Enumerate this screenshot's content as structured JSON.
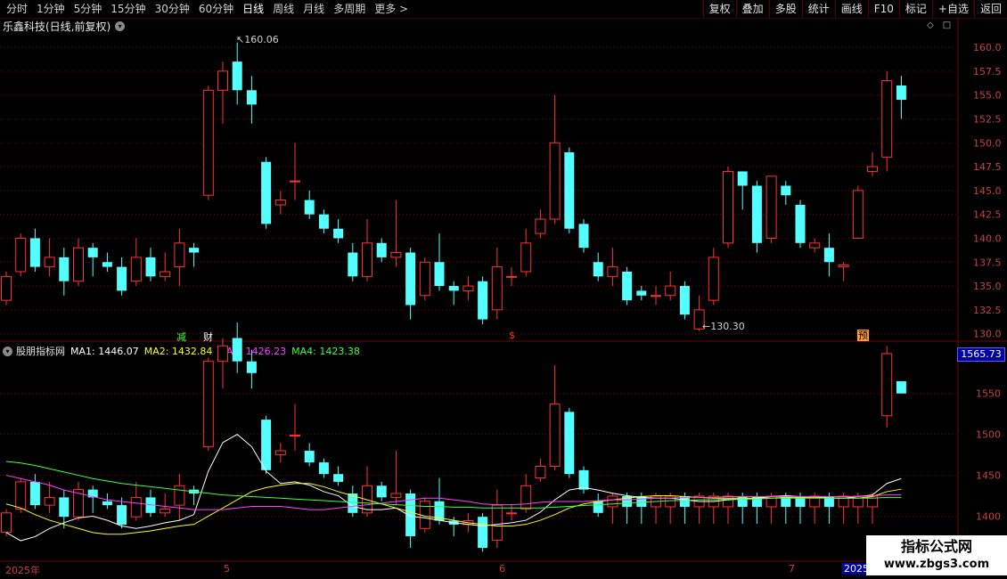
{
  "toolbar": {
    "periods": [
      "分时",
      "1分钟",
      "5分钟",
      "15分钟",
      "30分钟",
      "60分钟",
      "日线",
      "周线",
      "月线",
      "多周期",
      "更多 >"
    ],
    "active_period": "日线",
    "right_buttons": [
      "复权",
      "叠加",
      "多股",
      "统计",
      "画线",
      "F10",
      "标记",
      "+自选",
      "返回"
    ]
  },
  "stock": {
    "title": "乐鑫科技(日线,前复权)",
    "high_label": "160.06",
    "low_label": "130.30"
  },
  "markers": {
    "m1": "减",
    "m2": "财",
    "m3": "$",
    "m4": "预"
  },
  "indicator": {
    "name": "股朋指标网",
    "ma1": "MA1: 1446.07",
    "ma2": "MA2: 1432.84",
    "ma3": "MA3: 1426.23",
    "ma4": "MA4: 1423.38",
    "current_value": "1565.73"
  },
  "time_axis": {
    "labels": [
      "2025年",
      "5",
      "6",
      "7"
    ],
    "right_label": "2025"
  },
  "colors": {
    "up": "#ff3232",
    "down": "#54ffff",
    "ma1": "#ffffff",
    "ma2": "#ffff00",
    "ma3": "#ff40ff",
    "ma4": "#40ff40",
    "grid": "#7a0000",
    "axis_text": "#c84040"
  },
  "watermark": {
    "title": "指标公式网",
    "url": "www.zbgs3.com"
  },
  "chart_data": [
    {
      "type": "candlestick",
      "title": "乐鑫科技(日线,前复权)",
      "y_ticks": [
        130.0,
        132.5,
        135.0,
        137.5,
        140.0,
        142.5,
        145.0,
        147.5,
        150.0,
        152.5,
        155.0,
        157.5,
        160.0
      ],
      "ylim": [
        129.5,
        161.5
      ],
      "candles": [
        [
          133.5,
          136.0,
          133.0,
          136.5
        ],
        [
          136.5,
          140.0,
          136.0,
          140.5
        ],
        [
          140.0,
          137.0,
          136.5,
          141.0
        ],
        [
          137.0,
          138.0,
          136.0,
          140.0
        ],
        [
          138.0,
          135.5,
          134.0,
          139.0
        ],
        [
          135.5,
          139.0,
          135.0,
          140.0
        ],
        [
          139.0,
          138.0,
          136.0,
          139.5
        ],
        [
          137.5,
          137.0,
          136.5,
          138.5
        ],
        [
          137.0,
          134.5,
          134.0,
          138.0
        ],
        [
          135.5,
          138.0,
          135.0,
          140.0
        ],
        [
          138.0,
          136.0,
          135.5,
          139.0
        ],
        [
          136.0,
          136.5,
          135.5,
          138.5
        ],
        [
          137.0,
          139.5,
          135.0,
          141.0
        ],
        [
          139.0,
          138.5,
          137.0,
          139.5
        ],
        [
          144.5,
          155.5,
          144.0,
          156.0
        ],
        [
          155.5,
          157.5,
          152.0,
          158.5
        ],
        [
          158.5,
          155.5,
          154.0,
          160.5
        ],
        [
          155.5,
          154.0,
          152.0,
          157.0
        ],
        [
          148.0,
          141.5,
          141.0,
          148.5
        ],
        [
          143.5,
          144.0,
          142.5,
          145.0
        ],
        [
          146.0,
          146.0,
          144.0,
          150.0
        ],
        [
          144.0,
          142.5,
          142.0,
          145.0
        ],
        [
          142.5,
          141.0,
          140.5,
          143.0
        ],
        [
          141.0,
          140.0,
          139.5,
          142.0
        ],
        [
          138.5,
          136.0,
          135.5,
          139.5
        ],
        [
          136.0,
          139.5,
          135.5,
          142.0
        ],
        [
          139.5,
          138.0,
          137.5,
          140.0
        ],
        [
          138.0,
          138.5,
          137.0,
          144.0
        ],
        [
          138.5,
          133.0,
          131.5,
          139.0
        ],
        [
          134.0,
          137.5,
          133.5,
          138.0
        ],
        [
          137.5,
          135.0,
          134.5,
          140.5
        ],
        [
          135.0,
          134.5,
          133.0,
          135.5
        ],
        [
          134.5,
          135.0,
          133.5,
          136.0
        ],
        [
          135.5,
          131.5,
          131.0,
          136.0
        ],
        [
          132.5,
          137.0,
          131.5,
          139.0
        ],
        [
          136.0,
          136.0,
          135.0,
          137.0
        ],
        [
          136.5,
          139.5,
          136.0,
          141.0
        ],
        [
          140.5,
          142.0,
          140.0,
          143.0
        ],
        [
          142.0,
          150.0,
          141.5,
          155.0
        ],
        [
          149.0,
          141.0,
          140.5,
          149.5
        ],
        [
          141.5,
          139.0,
          138.5,
          142.0
        ],
        [
          137.5,
          136.0,
          135.5,
          138.5
        ],
        [
          136.0,
          137.0,
          135.0,
          139.0
        ],
        [
          136.5,
          133.5,
          133.0,
          137.0
        ],
        [
          134.5,
          134.0,
          133.5,
          135.0
        ],
        [
          134.0,
          134.0,
          133.0,
          135.0
        ],
        [
          134.0,
          135.0,
          133.5,
          136.5
        ],
        [
          135.0,
          132.0,
          131.5,
          135.5
        ],
        [
          130.5,
          132.5,
          130.3,
          134.0
        ],
        [
          133.5,
          138.0,
          133.0,
          139.0
        ],
        [
          139.5,
          147.0,
          139.0,
          147.5
        ],
        [
          147.0,
          145.5,
          143.0,
          147.0
        ],
        [
          145.5,
          139.5,
          138.5,
          146.0
        ],
        [
          140.0,
          146.5,
          139.5,
          146.5
        ],
        [
          145.5,
          144.5,
          143.5,
          146.0
        ],
        [
          143.5,
          139.5,
          139.0,
          144.0
        ],
        [
          139.0,
          139.5,
          138.5,
          140.0
        ],
        [
          139.0,
          137.5,
          136.0,
          140.5
        ],
        [
          137.0,
          137.2,
          135.5,
          137.5
        ],
        [
          140.0,
          145.0,
          143.0,
          145.5
        ],
        [
          147.0,
          147.5,
          146.5,
          149.0
        ],
        [
          148.5,
          156.5,
          147.0,
          157.5
        ],
        [
          156.0,
          154.5,
          152.5,
          157.0
        ]
      ]
    },
    {
      "type": "candlestick",
      "title": "股朋指标网",
      "y_ticks": [
        1400,
        1450,
        1500,
        1550
      ],
      "ylim": [
        1345,
        1590
      ],
      "series": [
        {
          "name": "MA1",
          "values": [
            1380,
            1370,
            1375,
            1385,
            1392,
            1398,
            1400,
            1395,
            1388,
            1385,
            1388,
            1392,
            1395,
            1402,
            1455,
            1490,
            1500,
            1485,
            1455,
            1440,
            1442,
            1438,
            1430,
            1425,
            1412,
            1408,
            1408,
            1410,
            1400,
            1398,
            1395,
            1392,
            1390,
            1388,
            1390,
            1392,
            1395,
            1405,
            1420,
            1432,
            1435,
            1432,
            1428,
            1425,
            1423,
            1422,
            1422,
            1420,
            1418,
            1418,
            1420,
            1421,
            1422,
            1424,
            1425,
            1424,
            1424,
            1422,
            1422,
            1424,
            1426,
            1440,
            1446
          ]
        },
        {
          "name": "MA2",
          "values": [
            1415,
            1410,
            1402,
            1395,
            1390,
            1385,
            1380,
            1378,
            1378,
            1380,
            1382,
            1385,
            1388,
            1390,
            1400,
            1410,
            1420,
            1430,
            1435,
            1438,
            1440,
            1440,
            1436,
            1430,
            1425,
            1420,
            1415,
            1410,
            1405,
            1400,
            1398,
            1395,
            1392,
            1390,
            1388,
            1388,
            1390,
            1395,
            1402,
            1410,
            1415,
            1418,
            1420,
            1422,
            1424,
            1425,
            1425,
            1424,
            1423,
            1422,
            1422,
            1422,
            1422,
            1422,
            1423,
            1423,
            1423,
            1422,
            1422,
            1422,
            1424,
            1430,
            1433
          ]
        },
        {
          "name": "MA3",
          "values": [
            1450,
            1446,
            1442,
            1438,
            1432,
            1428,
            1424,
            1420,
            1418,
            1416,
            1414,
            1412,
            1410,
            1408,
            1408,
            1408,
            1410,
            1412,
            1412,
            1412,
            1410,
            1408,
            1408,
            1410,
            1412,
            1414,
            1416,
            1418,
            1420,
            1422,
            1422,
            1420,
            1418,
            1415,
            1414,
            1414,
            1415,
            1417,
            1418,
            1418,
            1418,
            1419,
            1420,
            1420,
            1421,
            1422,
            1422,
            1423,
            1423,
            1423,
            1424,
            1424,
            1424,
            1424,
            1424,
            1424,
            1424,
            1424,
            1424,
            1424,
            1425,
            1426,
            1426
          ]
        },
        {
          "name": "MA4",
          "values": [
            1467,
            1465,
            1462,
            1458,
            1454,
            1450,
            1446,
            1443,
            1440,
            1438,
            1436,
            1434,
            1432,
            1430,
            1428,
            1426,
            1425,
            1424,
            1423,
            1422,
            1421,
            1420,
            1419,
            1418,
            1417,
            1416,
            1415,
            1414,
            1413,
            1412,
            1412,
            1411,
            1411,
            1410,
            1410,
            1410,
            1410,
            1410,
            1411,
            1412,
            1413,
            1414,
            1415,
            1416,
            1417,
            1418,
            1419,
            1419,
            1420,
            1420,
            1421,
            1421,
            1421,
            1422,
            1422,
            1422,
            1422,
            1422,
            1422,
            1422,
            1422,
            1423,
            1423
          ]
        }
      ]
    }
  ]
}
